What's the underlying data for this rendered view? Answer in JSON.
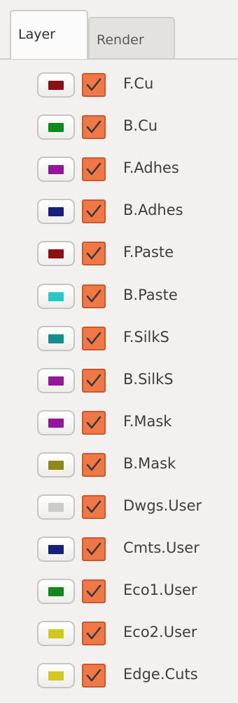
{
  "tabs": [
    {
      "label": "Layer",
      "active": true
    },
    {
      "label": "Render",
      "active": false
    }
  ],
  "layers": [
    {
      "name": "F.Cu",
      "color": "#8b1015",
      "visible": true
    },
    {
      "name": "B.Cu",
      "color": "#0f8a1a",
      "visible": true
    },
    {
      "name": "F.Adhes",
      "color": "#94179b",
      "visible": true
    },
    {
      "name": "B.Adhes",
      "color": "#17207f",
      "visible": true
    },
    {
      "name": "F.Paste",
      "color": "#8b1015",
      "visible": true
    },
    {
      "name": "B.Paste",
      "color": "#25c9c6",
      "visible": true
    },
    {
      "name": "F.SilkS",
      "color": "#16908f",
      "visible": true
    },
    {
      "name": "B.SilkS",
      "color": "#94179b",
      "visible": true
    },
    {
      "name": "F.Mask",
      "color": "#94179b",
      "visible": true
    },
    {
      "name": "B.Mask",
      "color": "#8d8a16",
      "visible": true
    },
    {
      "name": "Dwgs.User",
      "color": "#cbcbcb",
      "visible": true
    },
    {
      "name": "Cmts.User",
      "color": "#17207f",
      "visible": true
    },
    {
      "name": "Eco1.User",
      "color": "#0f8a1a",
      "visible": true
    },
    {
      "name": "Eco2.User",
      "color": "#d0c91c",
      "visible": true
    },
    {
      "name": "Edge.Cuts",
      "color": "#d0c91c",
      "visible": true
    }
  ]
}
